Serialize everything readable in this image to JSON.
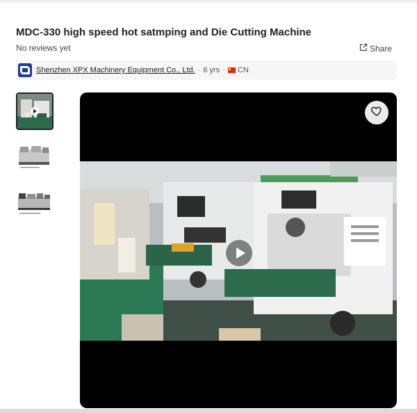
{
  "product": {
    "title": "MDC-330 high speed hot satmping and Die Cutting Machine",
    "reviews": "No reviews yet",
    "share_label": "Share"
  },
  "supplier": {
    "name": "Shenzhen XPX Machinery Equipment Co., Ltd.",
    "years": "6 yrs",
    "country": "CN"
  },
  "gallery": {
    "thumbnails": [
      {
        "type": "video",
        "icon": "play-icon"
      },
      {
        "type": "image"
      },
      {
        "type": "image"
      }
    ],
    "main_media": "video"
  },
  "colors": {
    "text": "#222222",
    "viewer_background": "#000000",
    "supplier_bar": "#f6f6f6"
  },
  "icons": [
    "share-icon",
    "supplier-logo-icon",
    "flag-cn-icon",
    "heart-icon",
    "play-icon"
  ]
}
